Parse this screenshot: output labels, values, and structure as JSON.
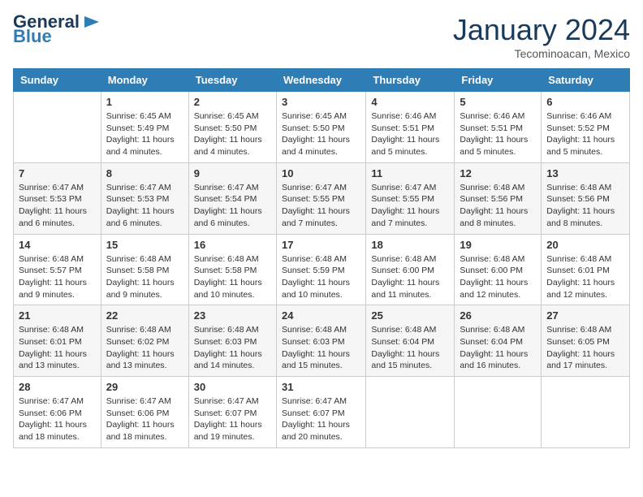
{
  "header": {
    "logo_general": "General",
    "logo_blue": "Blue",
    "month_title": "January 2024",
    "subtitle": "Tecominoacan, Mexico"
  },
  "days_of_week": [
    "Sunday",
    "Monday",
    "Tuesday",
    "Wednesday",
    "Thursday",
    "Friday",
    "Saturday"
  ],
  "weeks": [
    [
      {
        "day": "",
        "sunrise": "",
        "sunset": "",
        "daylight": ""
      },
      {
        "day": "1",
        "sunrise": "Sunrise: 6:45 AM",
        "sunset": "Sunset: 5:49 PM",
        "daylight": "Daylight: 11 hours and 4 minutes."
      },
      {
        "day": "2",
        "sunrise": "Sunrise: 6:45 AM",
        "sunset": "Sunset: 5:50 PM",
        "daylight": "Daylight: 11 hours and 4 minutes."
      },
      {
        "day": "3",
        "sunrise": "Sunrise: 6:45 AM",
        "sunset": "Sunset: 5:50 PM",
        "daylight": "Daylight: 11 hours and 4 minutes."
      },
      {
        "day": "4",
        "sunrise": "Sunrise: 6:46 AM",
        "sunset": "Sunset: 5:51 PM",
        "daylight": "Daylight: 11 hours and 5 minutes."
      },
      {
        "day": "5",
        "sunrise": "Sunrise: 6:46 AM",
        "sunset": "Sunset: 5:51 PM",
        "daylight": "Daylight: 11 hours and 5 minutes."
      },
      {
        "day": "6",
        "sunrise": "Sunrise: 6:46 AM",
        "sunset": "Sunset: 5:52 PM",
        "daylight": "Daylight: 11 hours and 5 minutes."
      }
    ],
    [
      {
        "day": "7",
        "sunrise": "Sunrise: 6:47 AM",
        "sunset": "Sunset: 5:53 PM",
        "daylight": "Daylight: 11 hours and 6 minutes."
      },
      {
        "day": "8",
        "sunrise": "Sunrise: 6:47 AM",
        "sunset": "Sunset: 5:53 PM",
        "daylight": "Daylight: 11 hours and 6 minutes."
      },
      {
        "day": "9",
        "sunrise": "Sunrise: 6:47 AM",
        "sunset": "Sunset: 5:54 PM",
        "daylight": "Daylight: 11 hours and 6 minutes."
      },
      {
        "day": "10",
        "sunrise": "Sunrise: 6:47 AM",
        "sunset": "Sunset: 5:55 PM",
        "daylight": "Daylight: 11 hours and 7 minutes."
      },
      {
        "day": "11",
        "sunrise": "Sunrise: 6:47 AM",
        "sunset": "Sunset: 5:55 PM",
        "daylight": "Daylight: 11 hours and 7 minutes."
      },
      {
        "day": "12",
        "sunrise": "Sunrise: 6:48 AM",
        "sunset": "Sunset: 5:56 PM",
        "daylight": "Daylight: 11 hours and 8 minutes."
      },
      {
        "day": "13",
        "sunrise": "Sunrise: 6:48 AM",
        "sunset": "Sunset: 5:56 PM",
        "daylight": "Daylight: 11 hours and 8 minutes."
      }
    ],
    [
      {
        "day": "14",
        "sunrise": "Sunrise: 6:48 AM",
        "sunset": "Sunset: 5:57 PM",
        "daylight": "Daylight: 11 hours and 9 minutes."
      },
      {
        "day": "15",
        "sunrise": "Sunrise: 6:48 AM",
        "sunset": "Sunset: 5:58 PM",
        "daylight": "Daylight: 11 hours and 9 minutes."
      },
      {
        "day": "16",
        "sunrise": "Sunrise: 6:48 AM",
        "sunset": "Sunset: 5:58 PM",
        "daylight": "Daylight: 11 hours and 10 minutes."
      },
      {
        "day": "17",
        "sunrise": "Sunrise: 6:48 AM",
        "sunset": "Sunset: 5:59 PM",
        "daylight": "Daylight: 11 hours and 10 minutes."
      },
      {
        "day": "18",
        "sunrise": "Sunrise: 6:48 AM",
        "sunset": "Sunset: 6:00 PM",
        "daylight": "Daylight: 11 hours and 11 minutes."
      },
      {
        "day": "19",
        "sunrise": "Sunrise: 6:48 AM",
        "sunset": "Sunset: 6:00 PM",
        "daylight": "Daylight: 11 hours and 12 minutes."
      },
      {
        "day": "20",
        "sunrise": "Sunrise: 6:48 AM",
        "sunset": "Sunset: 6:01 PM",
        "daylight": "Daylight: 11 hours and 12 minutes."
      }
    ],
    [
      {
        "day": "21",
        "sunrise": "Sunrise: 6:48 AM",
        "sunset": "Sunset: 6:01 PM",
        "daylight": "Daylight: 11 hours and 13 minutes."
      },
      {
        "day": "22",
        "sunrise": "Sunrise: 6:48 AM",
        "sunset": "Sunset: 6:02 PM",
        "daylight": "Daylight: 11 hours and 13 minutes."
      },
      {
        "day": "23",
        "sunrise": "Sunrise: 6:48 AM",
        "sunset": "Sunset: 6:03 PM",
        "daylight": "Daylight: 11 hours and 14 minutes."
      },
      {
        "day": "24",
        "sunrise": "Sunrise: 6:48 AM",
        "sunset": "Sunset: 6:03 PM",
        "daylight": "Daylight: 11 hours and 15 minutes."
      },
      {
        "day": "25",
        "sunrise": "Sunrise: 6:48 AM",
        "sunset": "Sunset: 6:04 PM",
        "daylight": "Daylight: 11 hours and 15 minutes."
      },
      {
        "day": "26",
        "sunrise": "Sunrise: 6:48 AM",
        "sunset": "Sunset: 6:04 PM",
        "daylight": "Daylight: 11 hours and 16 minutes."
      },
      {
        "day": "27",
        "sunrise": "Sunrise: 6:48 AM",
        "sunset": "Sunset: 6:05 PM",
        "daylight": "Daylight: 11 hours and 17 minutes."
      }
    ],
    [
      {
        "day": "28",
        "sunrise": "Sunrise: 6:47 AM",
        "sunset": "Sunset: 6:06 PM",
        "daylight": "Daylight: 11 hours and 18 minutes."
      },
      {
        "day": "29",
        "sunrise": "Sunrise: 6:47 AM",
        "sunset": "Sunset: 6:06 PM",
        "daylight": "Daylight: 11 hours and 18 minutes."
      },
      {
        "day": "30",
        "sunrise": "Sunrise: 6:47 AM",
        "sunset": "Sunset: 6:07 PM",
        "daylight": "Daylight: 11 hours and 19 minutes."
      },
      {
        "day": "31",
        "sunrise": "Sunrise: 6:47 AM",
        "sunset": "Sunset: 6:07 PM",
        "daylight": "Daylight: 11 hours and 20 minutes."
      },
      {
        "day": "",
        "sunrise": "",
        "sunset": "",
        "daylight": ""
      },
      {
        "day": "",
        "sunrise": "",
        "sunset": "",
        "daylight": ""
      },
      {
        "day": "",
        "sunrise": "",
        "sunset": "",
        "daylight": ""
      }
    ]
  ]
}
